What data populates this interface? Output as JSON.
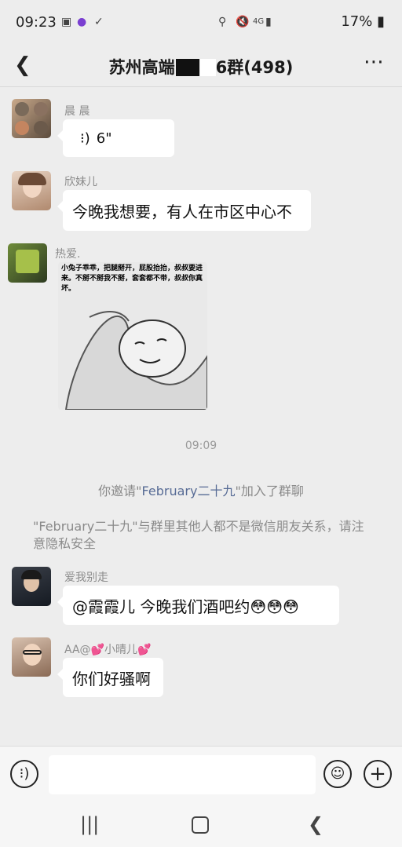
{
  "status_bar": {
    "time": "09:23",
    "network": "4G",
    "battery": "17%"
  },
  "header": {
    "title_prefix": "苏州高端",
    "title_suffix": "6群(498)"
  },
  "messages": [
    {
      "sender": "晨 晨",
      "voice_duration": "6\""
    },
    {
      "sender": "欣妹儿",
      "text": "今晚我想要，有人在市区中心不"
    },
    {
      "sender": "热爱.",
      "image_caption": "小兔子乖乖，把腿掰开，屁股抬抬，叔叔要进来。不掰不掰我不掰，套套都不带，叔叔你真坏。"
    },
    {
      "sender": "爱我别走",
      "text": "@霞霞儿  今晚我们酒吧约😳😳😳"
    },
    {
      "sender": "AA@💕小晴儿💕",
      "text": "你们好骚啊"
    }
  ],
  "system": {
    "time": "09:09",
    "invite_prefix": "你邀请\"",
    "invite_name": "February二十九",
    "invite_suffix": "\"加入了群聊",
    "privacy_note": "\"February二十九\"与群里其他人都不是微信朋友关系，请注意隐私安全"
  },
  "input": {
    "placeholder": ""
  },
  "icons": [
    "back-icon",
    "more-icon",
    "voice-icon",
    "emoji-icon",
    "plus-icon",
    "recents-icon",
    "home-icon",
    "nav-back-icon"
  ]
}
